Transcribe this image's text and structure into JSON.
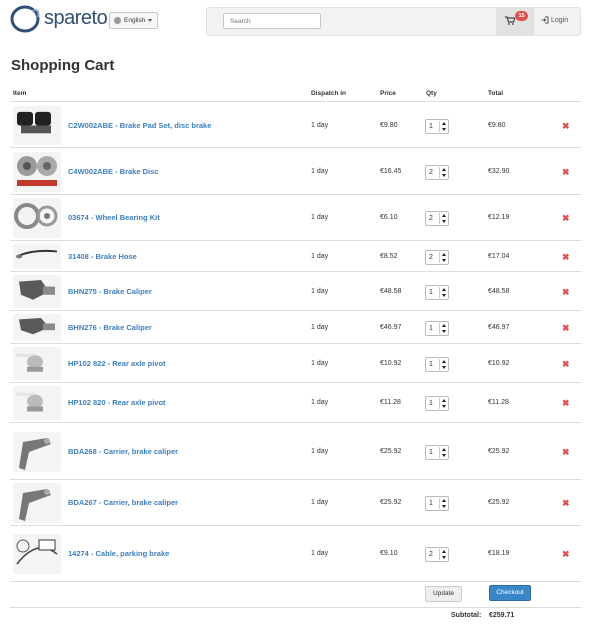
{
  "header": {
    "logo": "spareto",
    "language": "English",
    "search_placeholder": "Search",
    "cart_count": "15",
    "login": "Login"
  },
  "page_title": "Shopping Cart",
  "columns": {
    "item": "Item",
    "dispatch": "Dispatch in",
    "price": "Price",
    "qty": "Qty",
    "total": "Total"
  },
  "items": [
    {
      "name": "C2W002ABE - Brake Pad Set, disc brake",
      "dispatch": "1 day",
      "price": "€9.80",
      "qty": "1",
      "total": "€9.80",
      "icon": "brake-pads-image"
    },
    {
      "name": "C4W002ABE - Brake Disc",
      "dispatch": "1 day",
      "price": "€16.45",
      "qty": "2",
      "total": "€32.90",
      "icon": "brake-disc-image"
    },
    {
      "name": "03674 - Wheel Bearing Kit",
      "dispatch": "1 day",
      "price": "€6.10",
      "qty": "2",
      "total": "€12.19",
      "icon": "wheel-bearing-image"
    },
    {
      "name": "31408 - Brake Hose",
      "dispatch": "1 day",
      "price": "€8.52",
      "qty": "2",
      "total": "€17.04",
      "icon": "brake-hose-image"
    },
    {
      "name": "BHN275 - Brake Caliper",
      "dispatch": "1 day",
      "price": "€48.58",
      "qty": "1",
      "total": "€48.58",
      "icon": "brake-caliper-image"
    },
    {
      "name": "BHN276 - Brake Caliper",
      "dispatch": "1 day",
      "price": "€46.97",
      "qty": "1",
      "total": "€46.97",
      "icon": "brake-caliper-image"
    },
    {
      "name": "HP102 822 - Rear axle pivot",
      "dispatch": "1 day",
      "price": "€10.92",
      "qty": "1",
      "total": "€10.92",
      "icon": "axle-pivot-image"
    },
    {
      "name": "HP102 820 - Rear axle pivot",
      "dispatch": "1 day",
      "price": "€11.28",
      "qty": "1",
      "total": "€11.28",
      "icon": "axle-pivot-image"
    },
    {
      "name": "BDA268 - Carrier, brake caliper",
      "dispatch": "1 day",
      "price": "€25.92",
      "qty": "1",
      "total": "€25.92",
      "icon": "caliper-carrier-image"
    },
    {
      "name": "BDA267 - Carrier, brake caliper",
      "dispatch": "1 day",
      "price": "€25.92",
      "qty": "1",
      "total": "€25.92",
      "icon": "caliper-carrier-image"
    },
    {
      "name": "14274 - Cable, parking brake",
      "dispatch": "1 day",
      "price": "€9.10",
      "qty": "2",
      "total": "€18.19",
      "icon": "parking-cable-image"
    }
  ],
  "remove_glyph": "✖",
  "buttons": {
    "update": "Update",
    "checkout": "Checkout"
  },
  "subtotal": {
    "label": "Subtotal:",
    "value": "€259.71"
  },
  "colors": {
    "link": "#3f7fbf",
    "remove": "#d9534f",
    "checkout": "#3a87c8",
    "badge": "#d9534f"
  }
}
